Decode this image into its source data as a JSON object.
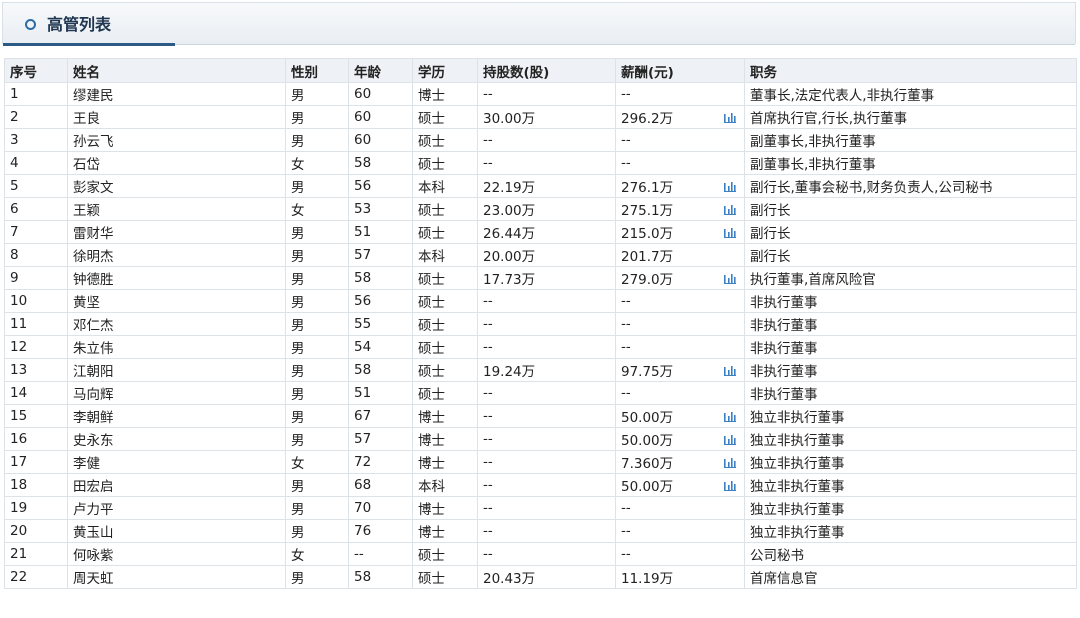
{
  "panel": {
    "title": "高管列表"
  },
  "table": {
    "headers": [
      "序号",
      "姓名",
      "性别",
      "年龄",
      "学历",
      "持股数(股)",
      "薪酬(元)",
      "职务"
    ],
    "rows": [
      {
        "no": "1",
        "name": "缪建民",
        "gender": "男",
        "age": "60",
        "edu": "博士",
        "shares": "--",
        "salary": "--",
        "chart": false,
        "title": "董事长,法定代表人,非执行董事"
      },
      {
        "no": "2",
        "name": "王良",
        "gender": "男",
        "age": "60",
        "edu": "硕士",
        "shares": "30.00万",
        "salary": "296.2万",
        "chart": true,
        "title": "首席执行官,行长,执行董事"
      },
      {
        "no": "3",
        "name": "孙云飞",
        "gender": "男",
        "age": "60",
        "edu": "硕士",
        "shares": "--",
        "salary": "--",
        "chart": false,
        "title": "副董事长,非执行董事"
      },
      {
        "no": "4",
        "name": "石岱",
        "gender": "女",
        "age": "58",
        "edu": "硕士",
        "shares": "--",
        "salary": "--",
        "chart": false,
        "title": "副董事长,非执行董事"
      },
      {
        "no": "5",
        "name": "彭家文",
        "gender": "男",
        "age": "56",
        "edu": "本科",
        "shares": "22.19万",
        "salary": "276.1万",
        "chart": true,
        "title": "副行长,董事会秘书,财务负责人,公司秘书"
      },
      {
        "no": "6",
        "name": "王颖",
        "gender": "女",
        "age": "53",
        "edu": "硕士",
        "shares": "23.00万",
        "salary": "275.1万",
        "chart": true,
        "title": "副行长"
      },
      {
        "no": "7",
        "name": "雷财华",
        "gender": "男",
        "age": "51",
        "edu": "硕士",
        "shares": "26.44万",
        "salary": "215.0万",
        "chart": true,
        "title": "副行长"
      },
      {
        "no": "8",
        "name": "徐明杰",
        "gender": "男",
        "age": "57",
        "edu": "本科",
        "shares": "20.00万",
        "salary": "201.7万",
        "chart": false,
        "title": "副行长"
      },
      {
        "no": "9",
        "name": "钟德胜",
        "gender": "男",
        "age": "58",
        "edu": "硕士",
        "shares": "17.73万",
        "salary": "279.0万",
        "chart": true,
        "title": "执行董事,首席风险官"
      },
      {
        "no": "10",
        "name": "黄坚",
        "gender": "男",
        "age": "56",
        "edu": "硕士",
        "shares": "--",
        "salary": "--",
        "chart": false,
        "title": "非执行董事"
      },
      {
        "no": "11",
        "name": "邓仁杰",
        "gender": "男",
        "age": "55",
        "edu": "硕士",
        "shares": "--",
        "salary": "--",
        "chart": false,
        "title": "非执行董事"
      },
      {
        "no": "12",
        "name": "朱立伟",
        "gender": "男",
        "age": "54",
        "edu": "硕士",
        "shares": "--",
        "salary": "--",
        "chart": false,
        "title": "非执行董事"
      },
      {
        "no": "13",
        "name": "江朝阳",
        "gender": "男",
        "age": "58",
        "edu": "硕士",
        "shares": "19.24万",
        "salary": "97.75万",
        "chart": true,
        "title": "非执行董事"
      },
      {
        "no": "14",
        "name": "马向辉",
        "gender": "男",
        "age": "51",
        "edu": "硕士",
        "shares": "--",
        "salary": "--",
        "chart": false,
        "title": "非执行董事"
      },
      {
        "no": "15",
        "name": "李朝鲜",
        "gender": "男",
        "age": "67",
        "edu": "博士",
        "shares": "--",
        "salary": "50.00万",
        "chart": true,
        "title": "独立非执行董事"
      },
      {
        "no": "16",
        "name": "史永东",
        "gender": "男",
        "age": "57",
        "edu": "博士",
        "shares": "--",
        "salary": "50.00万",
        "chart": true,
        "title": "独立非执行董事"
      },
      {
        "no": "17",
        "name": "李健",
        "gender": "女",
        "age": "72",
        "edu": "博士",
        "shares": "--",
        "salary": "7.360万",
        "chart": true,
        "title": "独立非执行董事"
      },
      {
        "no": "18",
        "name": "田宏启",
        "gender": "男",
        "age": "68",
        "edu": "本科",
        "shares": "--",
        "salary": "50.00万",
        "chart": true,
        "title": "独立非执行董事"
      },
      {
        "no": "19",
        "name": "卢力平",
        "gender": "男",
        "age": "70",
        "edu": "博士",
        "shares": "--",
        "salary": "--",
        "chart": false,
        "title": "独立非执行董事"
      },
      {
        "no": "20",
        "name": "黄玉山",
        "gender": "男",
        "age": "76",
        "edu": "博士",
        "shares": "--",
        "salary": "--",
        "chart": false,
        "title": "独立非执行董事"
      },
      {
        "no": "21",
        "name": "何咏紫",
        "gender": "女",
        "age": "--",
        "edu": "硕士",
        "shares": "--",
        "salary": "--",
        "chart": false,
        "title": "公司秘书"
      },
      {
        "no": "22",
        "name": "周天虹",
        "gender": "男",
        "age": "58",
        "edu": "硕士",
        "shares": "20.43万",
        "salary": "11.19万",
        "chart": false,
        "title": "首席信息官"
      }
    ]
  },
  "colors": {
    "accent": "#2b5a86",
    "icon": "#3b7fc4",
    "header_bg": "#eef2f6",
    "border": "#dde2e7"
  },
  "icons": {
    "title_marker": "circle-marker-icon",
    "salary_chart": "bar-chart-icon"
  }
}
